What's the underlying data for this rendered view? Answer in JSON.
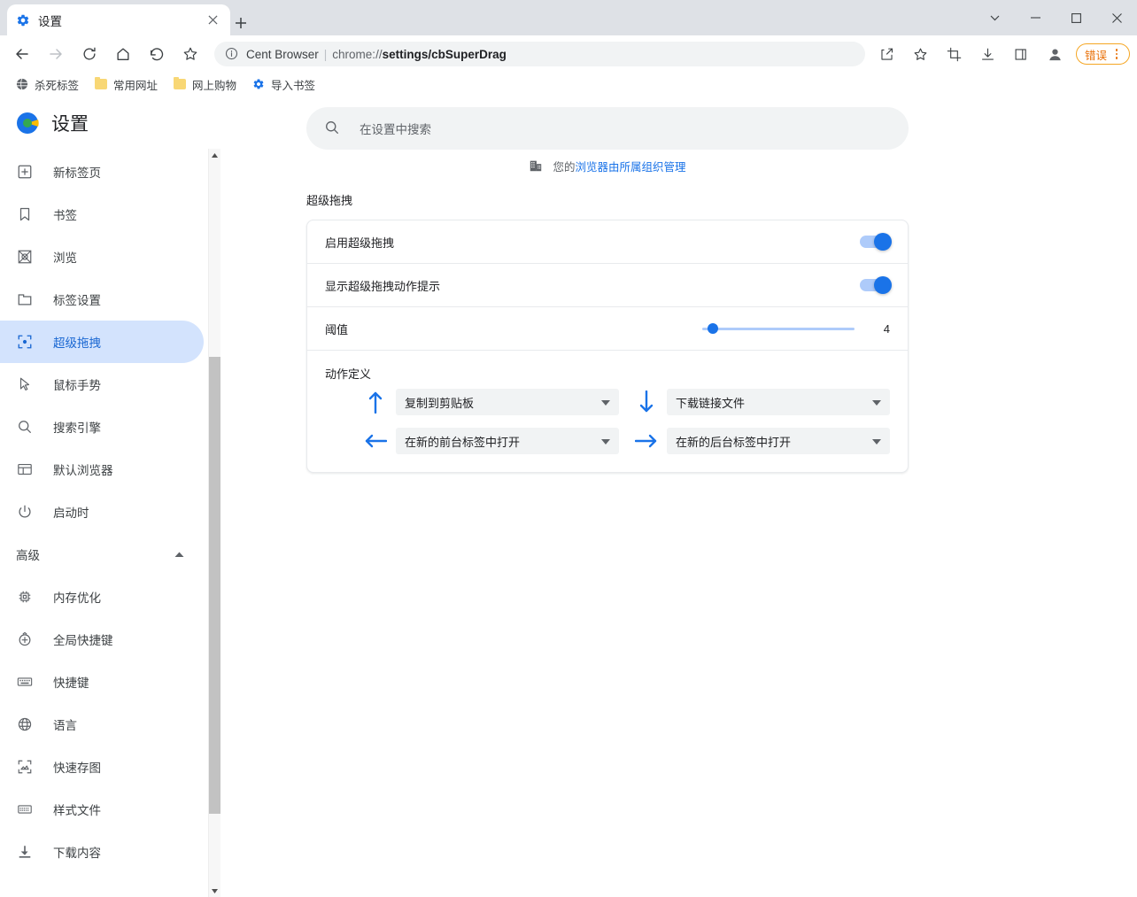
{
  "window": {
    "controls": [
      {
        "name": "tab-search-button",
        "icon": "chevron-down-icon"
      },
      {
        "name": "minimize-button",
        "icon": "minimize-icon"
      },
      {
        "name": "maximize-button",
        "icon": "maximize-icon"
      },
      {
        "name": "close-button",
        "icon": "close-icon"
      }
    ]
  },
  "tab": {
    "title": "设置",
    "favicon": "gear-icon",
    "close_label": "×",
    "new_tab_label": "+"
  },
  "toolbar": {
    "back_label": "←",
    "forward_label": "→",
    "reload_label": "↻",
    "home_label": "⌂",
    "undo_label": "↩",
    "bookmark_star_label": "☆",
    "omnibox": {
      "brand": "Cent Browser",
      "separator": "|",
      "url_scheme": "chrome://",
      "url_bold": "settings",
      "url_rest": "/cbSuperDrag",
      "full_url": "chrome://settings/cbSuperDrag"
    },
    "error_badge": {
      "label": "错误",
      "color": "#e8710a",
      "border_color": "#f5a623"
    }
  },
  "bookmarks": [
    {
      "label": "杀死标签",
      "icon": "globe-icon"
    },
    {
      "label": "常用网址",
      "icon": "folder-icon"
    },
    {
      "label": "网上购物",
      "icon": "folder-icon"
    },
    {
      "label": "导入书签",
      "icon": "gear-icon"
    }
  ],
  "settings": {
    "brand_title": "设置",
    "search": {
      "placeholder": "在设置中搜索",
      "icon": "search-icon"
    },
    "managed_notice": {
      "icon": "building-icon",
      "prefix": "您的",
      "link": "浏览器由所属组织管理"
    },
    "section_title": "超级拖拽",
    "sidebar": {
      "items": [
        {
          "label": "新标签页",
          "icon": "new-tab-icon",
          "active": false
        },
        {
          "label": "书签",
          "icon": "bookmark-icon",
          "active": false
        },
        {
          "label": "浏览",
          "icon": "browse-icon",
          "active": false
        },
        {
          "label": "标签设置",
          "icon": "tab-settings-icon",
          "active": false
        },
        {
          "label": "超级拖拽",
          "icon": "superdrag-icon",
          "active": true
        },
        {
          "label": "鼠标手势",
          "icon": "cursor-icon",
          "active": false
        },
        {
          "label": "搜索引擎",
          "icon": "search-icon",
          "active": false
        },
        {
          "label": "默认浏览器",
          "icon": "default-browser-icon",
          "active": false
        },
        {
          "label": "启动时",
          "icon": "power-icon",
          "active": false
        }
      ],
      "advanced_label": "高级",
      "advanced_expanded_icon": "chevron-up-icon",
      "advanced_items": [
        {
          "label": "内存优化",
          "icon": "chip-icon"
        },
        {
          "label": "全局快捷键",
          "icon": "global-shortcut-icon"
        },
        {
          "label": "快捷键",
          "icon": "keyboard-icon"
        },
        {
          "label": "语言",
          "icon": "globe-icon"
        },
        {
          "label": "快速存图",
          "icon": "image-capture-icon"
        },
        {
          "label": "样式文件",
          "icon": "style-file-icon"
        },
        {
          "label": "下载内容",
          "icon": "download-icon"
        }
      ]
    },
    "rows": {
      "enable_superdrag": {
        "label": "启用超级拖拽",
        "enabled": true
      },
      "show_action_hint": {
        "label": "显示超级拖拽动作提示",
        "enabled": true
      },
      "threshold": {
        "label": "阈值",
        "value": "4",
        "min": 0,
        "max": 50,
        "percent": 4
      }
    },
    "actions": {
      "title": "动作定义",
      "items": [
        {
          "direction": "up",
          "arrow": "arrow-up-icon",
          "value": "复制到剪贴板"
        },
        {
          "direction": "down",
          "arrow": "arrow-down-icon",
          "value": "下载链接文件"
        },
        {
          "direction": "left",
          "arrow": "arrow-left-icon",
          "value": "在新的前台标签中打开"
        },
        {
          "direction": "right",
          "arrow": "arrow-right-icon",
          "value": "在新的后台标签中打开"
        }
      ]
    }
  }
}
